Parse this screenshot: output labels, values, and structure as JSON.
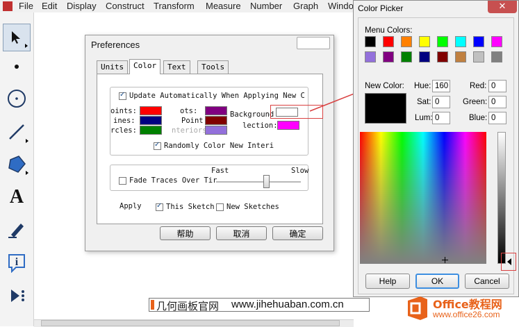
{
  "menubar": {
    "items": [
      "File",
      "Edit",
      "Display",
      "Construct",
      "Transform",
      "Measure",
      "Number",
      "Graph",
      "Windo"
    ]
  },
  "toolbar": {
    "tools": [
      "arrow-tool-icon",
      "point-tool-icon",
      "compass-tool-icon",
      "straightedge-tool-icon",
      "polygon-tool-icon",
      "text-tool-icon",
      "marker-tool-icon",
      "information-tool-icon",
      "custom-tool-icon"
    ],
    "text_tool_glyph": "A"
  },
  "preferences": {
    "title": "Preferences",
    "tabs": [
      "Units",
      "Color",
      "Text",
      "Tools"
    ],
    "active_tab": "Color",
    "update_auto_label": "Update Automatically When Applying New C",
    "color_rows": [
      {
        "left_label": "oints:",
        "left_color": "#ff0000",
        "mid_label": "ots:",
        "mid_color": "#800080",
        "right_label": "Background",
        "right_color": "#ffffff"
      },
      {
        "left_label": "ines:",
        "left_color": "#000080",
        "mid_label": "Point",
        "mid_color": "#800000",
        "right_label": "lection:",
        "right_color": "#ff00ff"
      },
      {
        "left_label": "rcles:",
        "left_color": "#008000",
        "mid_label": "nteriors:",
        "mid_color": "#9370db"
      }
    ],
    "random_color_label": "Randomly Color New Interi",
    "fade_traces_label": "Fade Traces Over Tir",
    "fast_label": "Fast",
    "slow_label": "Slow",
    "apply_label": "Apply",
    "this_sketch_label": "This Sketch",
    "new_sketches_label": "New Sketches",
    "buttons": {
      "help": "帮助",
      "cancel": "取消",
      "ok": "确定"
    }
  },
  "color_picker": {
    "title": "Color Picker",
    "close_glyph": "✕",
    "menu_colors_label": "Menu Colors:",
    "menu_colors": [
      "#000000",
      "#ff0000",
      "#ff8000",
      "#ffff00",
      "#00ff00",
      "#00ffff",
      "#0000ff",
      "#ff00ff",
      "#9370db",
      "#800080",
      "#008000",
      "#000080",
      "#800000",
      "#c08040",
      "#c0c0c0",
      "#808080"
    ],
    "new_color_label": "New Color:",
    "new_color": "#000000",
    "fields": {
      "hue_label": "Hue:",
      "hue": "160",
      "sat_label": "Sat:",
      "sat": "0",
      "lum_label": "Lum:",
      "lum": "0",
      "red_label": "Red:",
      "red": "0",
      "green_label": "Green:",
      "green": "0",
      "blue_label": "Blue:",
      "blue": "0"
    },
    "buttons": {
      "help": "Help",
      "ok": "OK",
      "cancel": "Cancel"
    }
  },
  "caption": {
    "cn": "几何画板官网",
    "url": "www.jihehuaban.com.cn"
  },
  "watermark": {
    "brand": "Office教程网",
    "url": "www.office26.com"
  },
  "colors": {
    "annotation_red": "#d94040",
    "ok_highlight": "#3d8ee0",
    "brand_orange": "#e8621a"
  }
}
